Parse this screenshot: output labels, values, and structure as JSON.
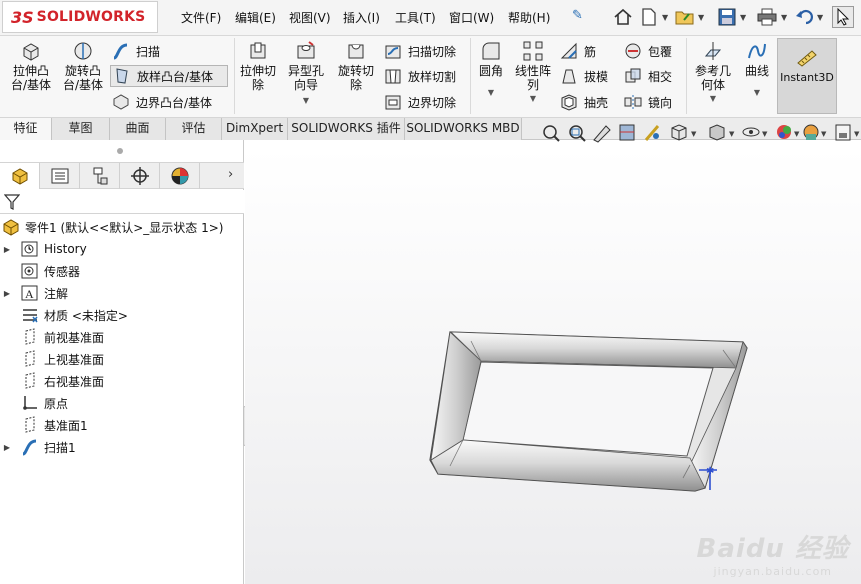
{
  "app": {
    "logo_text": "SOLIDWORKS"
  },
  "menu": [
    "文件(F)",
    "编辑(E)",
    "视图(V)",
    "插入(I)",
    "工具(T)",
    "窗口(W)",
    "帮助(H)"
  ],
  "features": {
    "extrude_boss": "拉伸凸\n台/基体",
    "revolve_boss": "旋转凸\n台/基体",
    "sweep": "扫描",
    "loft_boss": "放样凸台/基体",
    "boundary_boss": "边界凸台/基体",
    "extrude_cut": "拉伸切\n除",
    "hole_wizard": "异型孔\n向导",
    "revolve_cut": "旋转切\n除",
    "swept_cut": "扫描切除",
    "lofted_cut": "放样切割",
    "boundary_cut": "边界切除",
    "fillet": "圆角",
    "linear_pattern": "线性阵\n列",
    "rib": "筋",
    "draft": "拔模",
    "shell": "抽壳",
    "wrap": "包覆",
    "intersect": "相交",
    "mirror": "镜向",
    "reference_geometry": "参考几\n何体",
    "curves": "曲线",
    "instant3d": "Instant3D"
  },
  "tabs": [
    "特征",
    "草图",
    "曲面",
    "评估",
    "DimXpert",
    "SOLIDWORKS 插件",
    "SOLIDWORKS MBD"
  ],
  "tree": {
    "root": "零件1 (默认<<默认>_显示状态 1>)",
    "items": [
      "History",
      "传感器",
      "注解",
      "材质 <未指定>",
      "前视基准面",
      "上视基准面",
      "右视基准面",
      "原点",
      "基准面1",
      "扫描1"
    ]
  },
  "watermark": {
    "line1": "Baidu 经验",
    "line2": "jingyan.baidu.com"
  },
  "colors": {
    "brand": "#d2232a",
    "accent": "#2e6db4"
  }
}
